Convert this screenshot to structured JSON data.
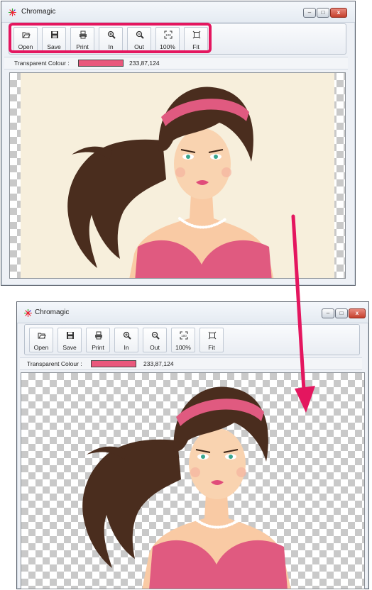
{
  "app": {
    "title": "Chromagic"
  },
  "window_controls": {
    "minimize_glyph": "–",
    "maximize_glyph": "□",
    "close_glyph": "x"
  },
  "toolbar": {
    "buttons": [
      {
        "label": "Open",
        "icon": "folder-open-icon"
      },
      {
        "label": "Save",
        "icon": "floppy-disk-icon"
      },
      {
        "label": "Print",
        "icon": "printer-icon"
      },
      {
        "label": "In",
        "icon": "zoom-in-icon"
      },
      {
        "label": "Out",
        "icon": "zoom-out-icon"
      },
      {
        "label": "100%",
        "icon": "actual-size-icon"
      },
      {
        "label": "Fit",
        "icon": "fit-to-window-icon"
      }
    ]
  },
  "transparent_colour": {
    "label": "Transparent Colour :",
    "rgb": "233,87,124",
    "hex": "#e9577c"
  },
  "colors": {
    "highlight_box": "#e4165f",
    "arrow": "#e4165f",
    "background_cream": "#f7efdc"
  }
}
